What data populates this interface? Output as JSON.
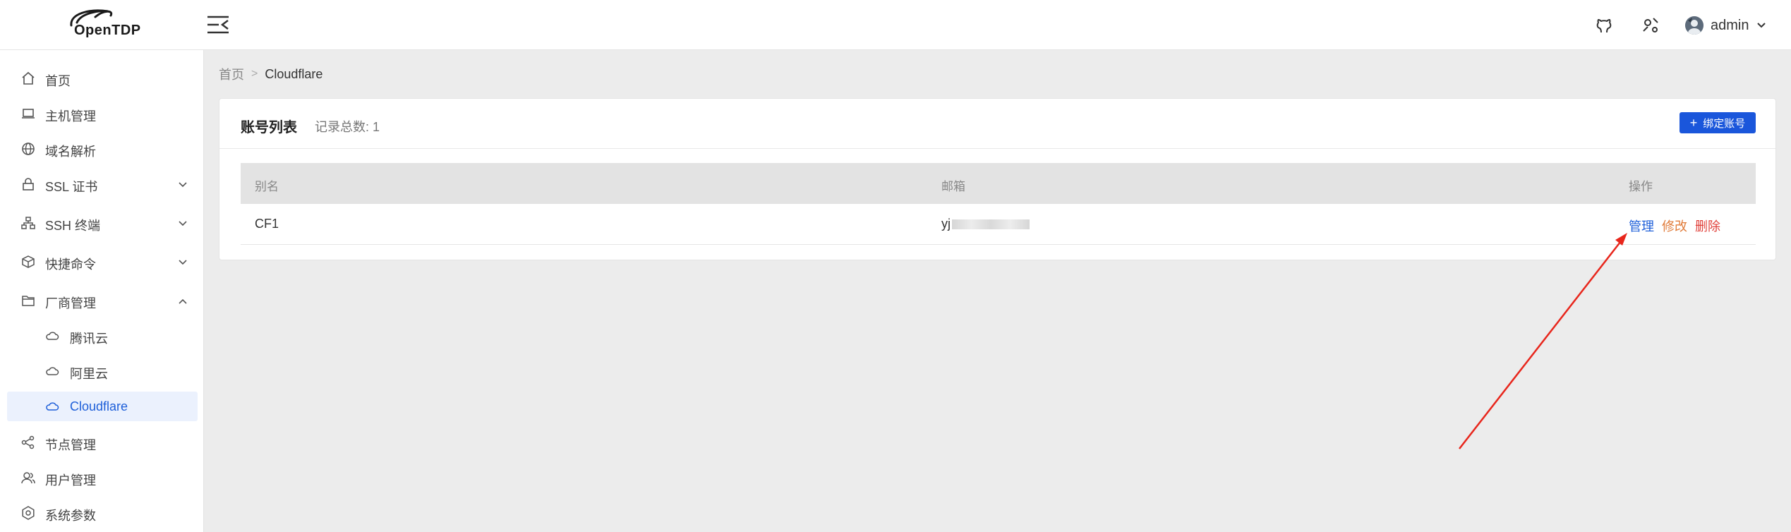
{
  "app": {
    "logo_text": "OpenTDP"
  },
  "header": {
    "username": "admin"
  },
  "sidebar": {
    "items": [
      {
        "label": "首页"
      },
      {
        "label": "主机管理"
      },
      {
        "label": "域名解析"
      },
      {
        "label": "SSL 证书"
      },
      {
        "label": "SSH 终端"
      },
      {
        "label": "快捷命令"
      },
      {
        "label": "厂商管理"
      },
      {
        "label": "腾讯云"
      },
      {
        "label": "阿里云"
      },
      {
        "label": "Cloudflare"
      },
      {
        "label": "节点管理"
      },
      {
        "label": "用户管理"
      },
      {
        "label": "系统参数"
      }
    ]
  },
  "breadcrumb": {
    "home": "首页",
    "separator": ">",
    "current": "Cloudflare"
  },
  "card": {
    "title": "账号列表",
    "count_label": "记录总数: 1",
    "bind_button": "绑定账号"
  },
  "table": {
    "columns": [
      "别名",
      "邮箱",
      "操作"
    ],
    "rows": [
      {
        "alias": "CF1",
        "email": "yj",
        "actions": [
          "管理",
          "修改",
          "删除"
        ]
      }
    ]
  },
  "colors": {
    "primary": "#1a56db",
    "manage": "#1e5fd9",
    "edit": "#e07b39",
    "delete": "#e0403a",
    "annotation_arrow": "#e8261c"
  }
}
